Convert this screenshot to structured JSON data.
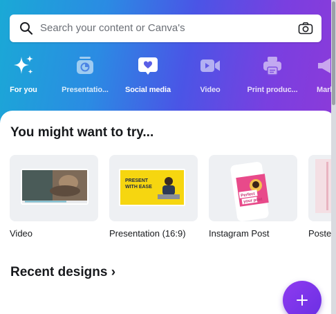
{
  "search": {
    "placeholder": "Search your content or Canva's",
    "search_icon": "search-icon",
    "camera_icon": "camera-icon"
  },
  "categories": [
    {
      "label": "For you",
      "icon": "sparkle-icon",
      "active": true
    },
    {
      "label": "Presentatio...",
      "icon": "presentation-icon",
      "active": false
    },
    {
      "label": "Social media",
      "icon": "heart-chat-icon",
      "active": false
    },
    {
      "label": "Video",
      "icon": "video-camera-icon",
      "active": false
    },
    {
      "label": "Print produc...",
      "icon": "printer-icon",
      "active": false
    },
    {
      "label": "Mark",
      "icon": "megaphone-icon",
      "active": false
    }
  ],
  "suggestions": {
    "title": "You might want to try...",
    "items": [
      {
        "label": "Video",
        "thumb_text": "Clear your mind through yoga and meditation"
      },
      {
        "label": "Presentation (16:9)",
        "thumb_text": "PRESENT WITH EASE"
      },
      {
        "label": "Instagram Post",
        "thumb_text": "Perfect your post"
      },
      {
        "label": "Poste",
        "thumb_text": ""
      }
    ]
  },
  "recent": {
    "title": "Recent designs ›"
  },
  "fab": {
    "icon": "plus-icon"
  },
  "colors": {
    "gradient_start": "#1aa9d6",
    "gradient_end": "#8c3ad9",
    "fab": "#7d35ea",
    "presentation_yellow": "#f6d610"
  }
}
